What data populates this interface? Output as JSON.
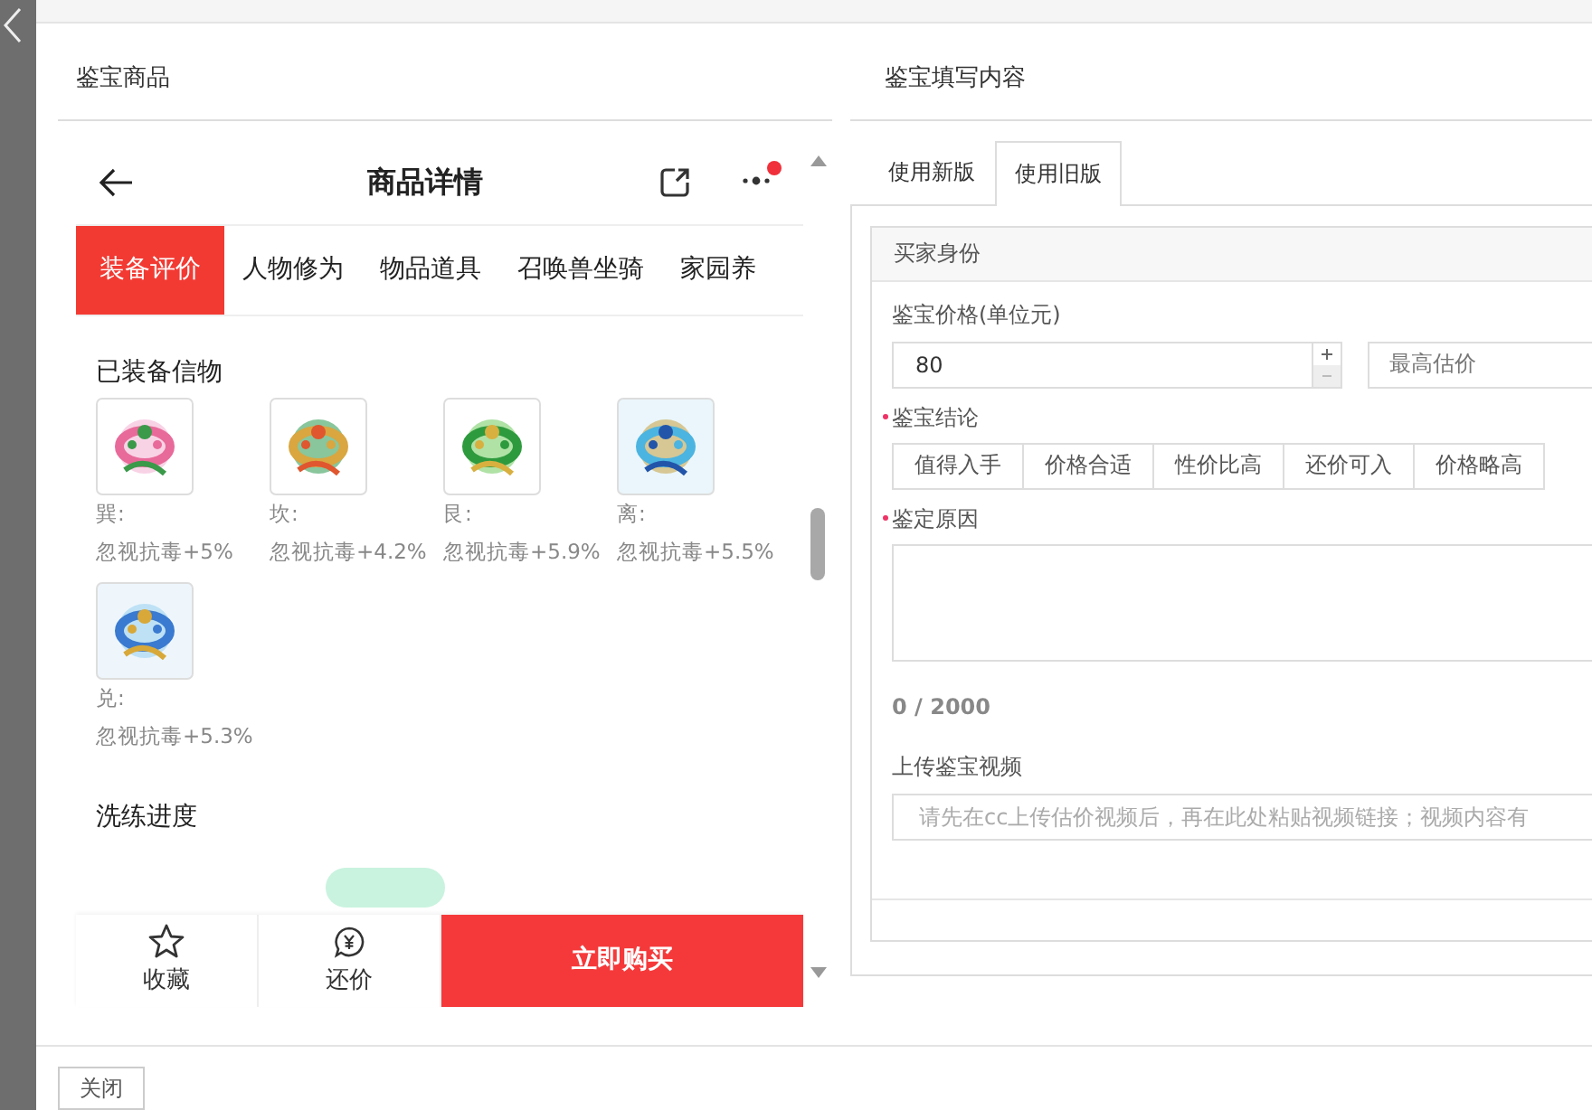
{
  "left_panel": {
    "title": "鉴宝商品",
    "phone": {
      "title": "商品详情",
      "has_notification": true,
      "tabs": [
        {
          "label": "装备评价",
          "selected": true
        },
        {
          "label": "人物修为",
          "selected": false
        },
        {
          "label": "物品道具",
          "selected": false
        },
        {
          "label": "召唤兽坐骑",
          "selected": false
        },
        {
          "label": "家园养",
          "selected": false
        }
      ],
      "section_title": "已装备信物",
      "items": [
        {
          "kind": "picture",
          "name": "巽:",
          "effect": "忽视抗毒+5%"
        },
        {
          "kind": "picture",
          "name": "坎:",
          "effect": "忽视抗毒+4.2%"
        },
        {
          "kind": "picture",
          "name": "艮:",
          "effect": "忽视抗毒+5.9%"
        },
        {
          "kind": "picture",
          "name": "离:",
          "effect": "忽视抗毒+5.5%"
        },
        {
          "kind": "picture",
          "name": "兑:",
          "effect": "忽视抗毒+5.3%"
        }
      ],
      "progress_title": "洗练进度",
      "bottom_bar": {
        "favorite": "收藏",
        "bargain": "还价",
        "buy": "立即购买"
      }
    },
    "close_button": "关闭"
  },
  "right_panel": {
    "title": "鉴宝填写内容",
    "tabs": [
      {
        "label": "使用新版",
        "selected": false
      },
      {
        "label": "使用旧版",
        "selected": true
      }
    ],
    "card_title": "买家身份",
    "price_label": "鉴宝价格(单位元)",
    "price_value": "80",
    "price_type_placeholder": "最高估价",
    "conclusion_label": "鉴宝结论",
    "conclusion_required": true,
    "conclusions": [
      {
        "label": "值得入手",
        "selected": false
      },
      {
        "label": "价格合适",
        "selected": false
      },
      {
        "label": "性价比高",
        "selected": false
      },
      {
        "label": "还价可入",
        "selected": false
      },
      {
        "label": "价格略高",
        "selected": false
      }
    ],
    "reason_label": "鉴定原因",
    "reason_required": true,
    "reason_count": "0 / 2000",
    "video_label": "上传鉴宝视频",
    "video_placeholder": "请先在cc上传估价视频后，再在此处粘贴视频链接；视频内容有"
  }
}
